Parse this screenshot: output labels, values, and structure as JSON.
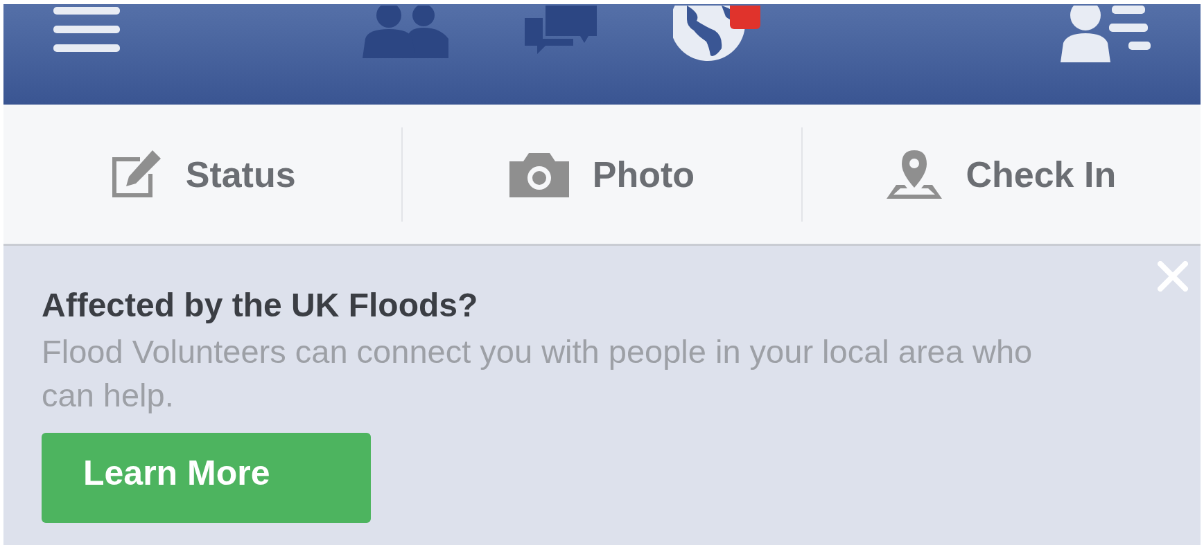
{
  "nav": [
    {
      "kind": "menu"
    },
    {
      "kind": "friends"
    },
    {
      "kind": "messages"
    },
    {
      "kind": "notifications"
    },
    {
      "kind": "profile"
    }
  ],
  "actions": [
    {
      "kind": "status",
      "label": "Status"
    },
    {
      "kind": "photo",
      "label": "Photo"
    },
    {
      "kind": "checkin",
      "label": "Check In"
    }
  ],
  "banner": {
    "title": "Affected by the UK Floods?",
    "body": "Flood Volunteers can connect you with people in your local area who can help.",
    "button": "Learn More"
  }
}
